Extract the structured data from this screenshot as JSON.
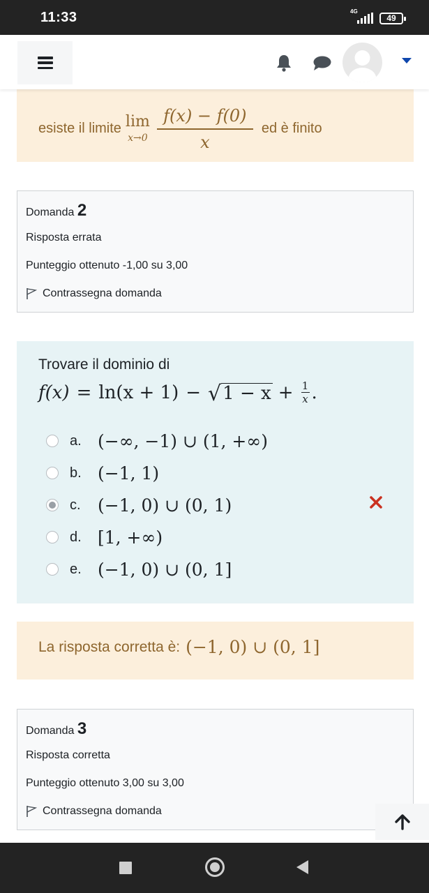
{
  "status_bar": {
    "time": "11:33",
    "network": "4G",
    "battery": "49"
  },
  "navbar": {
    "menu_icon": "hamburger-icon",
    "notifications_icon": "bell-icon",
    "messages_icon": "chat-bubble-icon",
    "user_icon": "avatar-icon",
    "dropdown_icon": "caret-down-icon",
    "accent": "#0f47ad"
  },
  "previous_feedback": {
    "prefix": "esiste il limite",
    "lim_word": "lim",
    "lim_sub": "x→0",
    "numerator": "f(x) − f(0)",
    "denominator": "x",
    "suffix": "ed è finito",
    "text_color": "#8e662e",
    "bg_color": "#fcefdc"
  },
  "question2": {
    "label": "Domanda",
    "number": "2",
    "state": "Risposta errata",
    "grade": "Punteggio ottenuto -1,00 su 3,00",
    "flag_label": "Contrassegna domanda",
    "prompt": "Trovare il dominio di",
    "formula": {
      "lhs": "f(x)",
      "eq": "=",
      "ln_part": "ln(x + 1)",
      "minus": "−",
      "sqrt_arg": "1 − x",
      "plus": "+",
      "frac_num": "1",
      "frac_den": "x",
      "end": "."
    },
    "options": [
      {
        "letter": "a.",
        "answer": "(−∞, −1) ∪ (1, +∞)",
        "selected": false
      },
      {
        "letter": "b.",
        "answer": "(−1, 1)",
        "selected": false
      },
      {
        "letter": "c.",
        "answer": "(−1, 0) ∪ (0, 1)",
        "selected": true
      },
      {
        "letter": "d.",
        "answer": "[1, +∞)",
        "selected": false
      },
      {
        "letter": "e.",
        "answer": "(−1, 0) ∪ (0, 1]",
        "selected": false
      }
    ],
    "incorrect_icon": "cross-icon",
    "incorrect_color": "#ca3120",
    "right_answer_label": "La risposta corretta è:",
    "right_answer": "(−1, 0) ∪ (0, 1]"
  },
  "question3": {
    "label": "Domanda",
    "number": "3",
    "state": "Risposta corretta",
    "grade": "Punteggio ottenuto 3,00 su 3,00",
    "flag_label": "Contrassegna domanda"
  },
  "back_to_top_icon": "arrow-up-icon",
  "android_nav": {
    "recents_icon": "square-icon",
    "home_icon": "home-circle-icon",
    "back_icon": "triangle-back-icon"
  }
}
